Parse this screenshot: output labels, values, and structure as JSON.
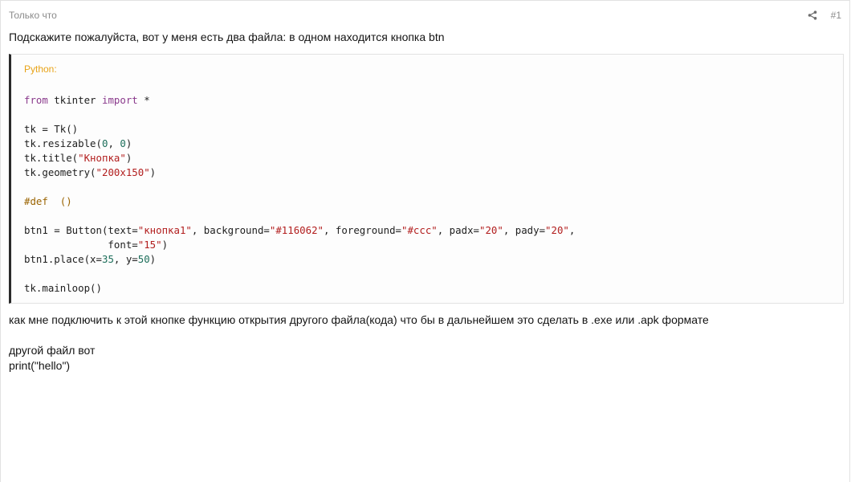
{
  "post": {
    "time": "Только что",
    "number": "#1",
    "share_icon": "share-icon"
  },
  "text": {
    "intro": "Подскажите пожалуйста, вот у меня есть два файла: в одном находится кнопка btn",
    "question": "как мне подключить к этой кнопке функцию открытия другого файла(кода) что бы в дальнейшем это сделать в .exe или .apk формате",
    "other_file": "другой файл вот",
    "print_line": "print(\"hello\")"
  },
  "code": {
    "language": "Python:",
    "lines": [
      [
        {
          "t": "kw",
          "v": "from"
        },
        {
          "t": "plain",
          "v": " tkinter "
        },
        {
          "t": "kw",
          "v": "import"
        },
        {
          "t": "plain",
          "v": " *"
        }
      ],
      [],
      [
        {
          "t": "plain",
          "v": "tk = Tk()"
        }
      ],
      [
        {
          "t": "plain",
          "v": "tk.resizable("
        },
        {
          "t": "num",
          "v": "0"
        },
        {
          "t": "plain",
          "v": ", "
        },
        {
          "t": "num",
          "v": "0"
        },
        {
          "t": "plain",
          "v": ")"
        }
      ],
      [
        {
          "t": "plain",
          "v": "tk.title("
        },
        {
          "t": "str",
          "v": "\"Кнопка\""
        },
        {
          "t": "plain",
          "v": ")"
        }
      ],
      [
        {
          "t": "plain",
          "v": "tk.geometry("
        },
        {
          "t": "str",
          "v": "\"200x150\""
        },
        {
          "t": "plain",
          "v": ")"
        }
      ],
      [],
      [
        {
          "t": "cm",
          "v": "#def  ()"
        }
      ],
      [],
      [
        {
          "t": "plain",
          "v": "btn1 = Button(text="
        },
        {
          "t": "str",
          "v": "\"кнопка1\""
        },
        {
          "t": "plain",
          "v": ", background="
        },
        {
          "t": "str",
          "v": "\"#116062\""
        },
        {
          "t": "plain",
          "v": ", foreground="
        },
        {
          "t": "str",
          "v": "\"#ccc\""
        },
        {
          "t": "plain",
          "v": ", padx="
        },
        {
          "t": "str",
          "v": "\"20\""
        },
        {
          "t": "plain",
          "v": ", pady="
        },
        {
          "t": "str",
          "v": "\"20\""
        },
        {
          "t": "plain",
          "v": ","
        }
      ],
      [
        {
          "t": "plain",
          "v": "              font="
        },
        {
          "t": "str",
          "v": "\"15\""
        },
        {
          "t": "plain",
          "v": ")"
        }
      ],
      [
        {
          "t": "plain",
          "v": "btn1.place(x="
        },
        {
          "t": "num",
          "v": "35"
        },
        {
          "t": "plain",
          "v": ", y="
        },
        {
          "t": "num",
          "v": "50"
        },
        {
          "t": "plain",
          "v": ")"
        }
      ],
      [],
      [
        {
          "t": "plain",
          "v": "tk.mainloop()"
        }
      ]
    ]
  },
  "colors": {
    "keyword": "#8a3a8c",
    "string": "#b21e1e",
    "number": "#1c6e5a",
    "comment": "#9a6300",
    "language_label": "#e8a317",
    "code_border_left": "#2a2a2a"
  }
}
